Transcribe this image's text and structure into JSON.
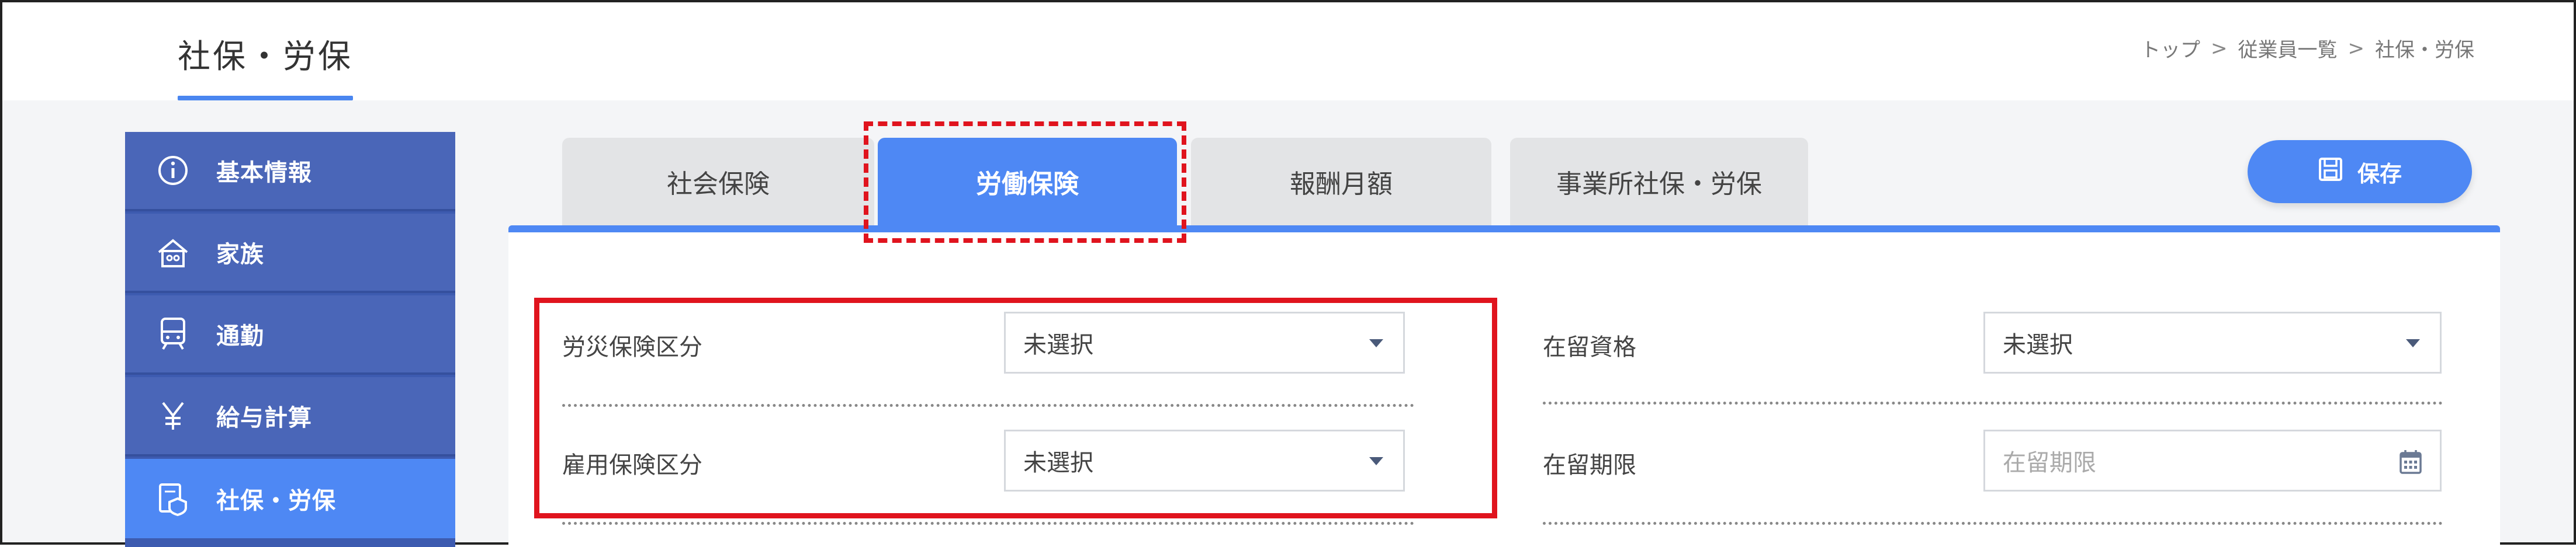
{
  "header": {
    "title": "社保・労保",
    "breadcrumb": [
      "トップ",
      "従業員一覧",
      "社保・労保"
    ],
    "breadcrumb_sep": ">"
  },
  "sidebar": {
    "items": [
      {
        "label": "基本情報",
        "icon": "info-icon"
      },
      {
        "label": "家族",
        "icon": "house-icon"
      },
      {
        "label": "通勤",
        "icon": "train-icon"
      },
      {
        "label": "給与計算",
        "icon": "yen-icon"
      },
      {
        "label": "社保・労保",
        "icon": "insurance-icon",
        "active": true
      }
    ]
  },
  "tabs": [
    {
      "label": "社会保険"
    },
    {
      "label": "労働保険",
      "active": true
    },
    {
      "label": "報酬月額"
    },
    {
      "label": "事業所社保・労保"
    }
  ],
  "toolbar": {
    "save_label": "保存",
    "save_icon": "save-icon"
  },
  "form": {
    "left": [
      {
        "label": "労災保険区分",
        "value": "未選択"
      },
      {
        "label": "雇用保険区分",
        "value": "未選択"
      }
    ],
    "right": [
      {
        "label": "在留資格",
        "value": "未選択"
      },
      {
        "label": "在留期限",
        "placeholder": "在留期限"
      }
    ]
  },
  "colors": {
    "accent": "#4e88f4",
    "sidebar": "#4a66b8",
    "highlight": "#e0141e"
  }
}
